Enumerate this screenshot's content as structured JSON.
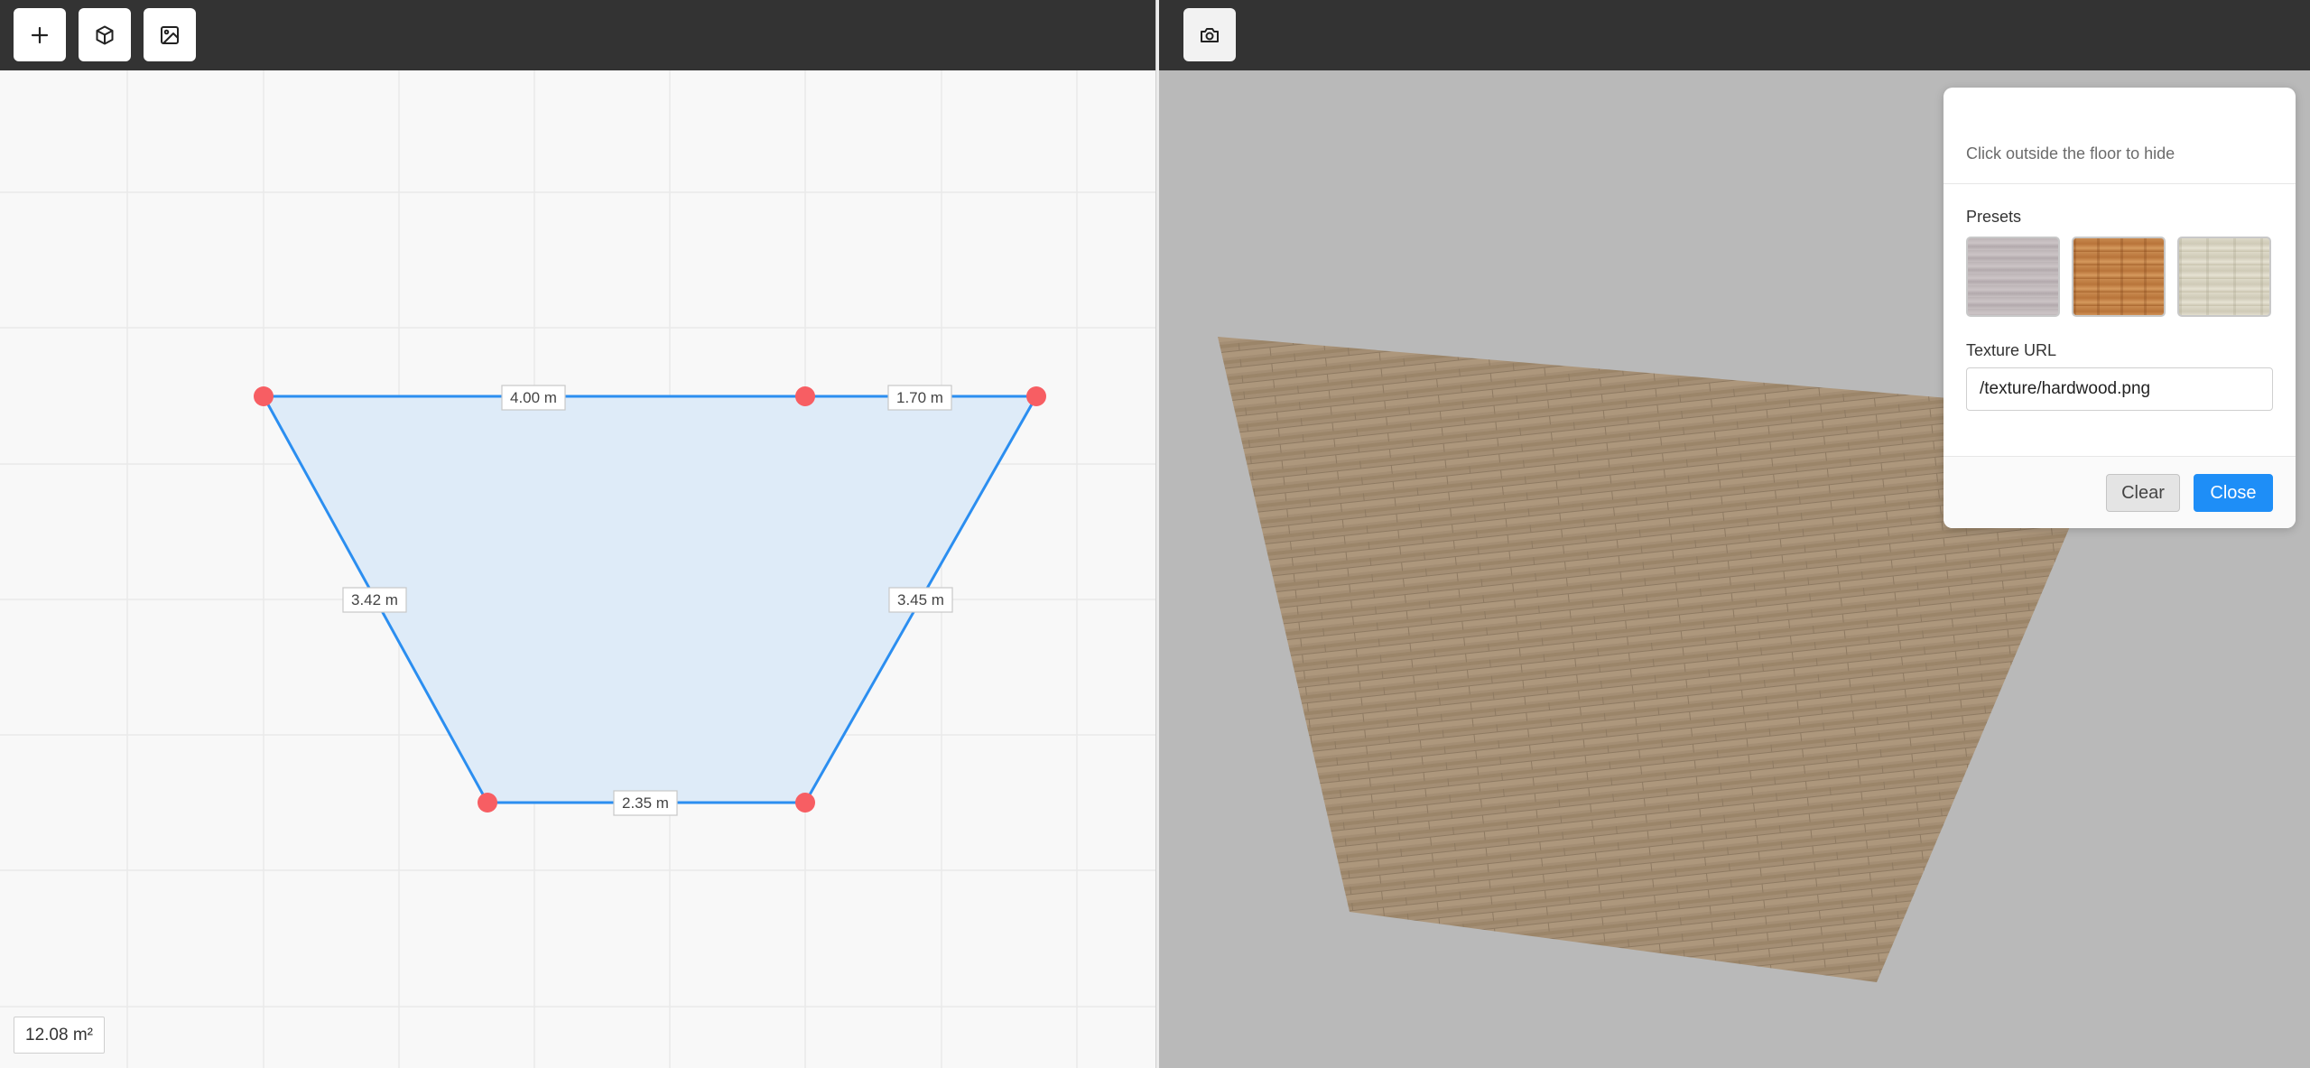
{
  "left_toolbar": {
    "buttons": [
      {
        "icon": "plus-icon",
        "label": "+"
      },
      {
        "icon": "cube-icon"
      },
      {
        "icon": "image-icon"
      }
    ]
  },
  "plan": {
    "dimensions": [
      {
        "edge": "top-left",
        "label": "4.00 m"
      },
      {
        "edge": "top-right",
        "label": "1.70 m"
      },
      {
        "edge": "left",
        "label": "3.42 m"
      },
      {
        "edge": "right",
        "label": "3.45 m"
      },
      {
        "edge": "bottom",
        "label": "2.35 m"
      }
    ],
    "area_label": "12.08 m²",
    "colors": {
      "fill": "#deebf8",
      "stroke": "#2b8ef0",
      "vertex": "#f75e63",
      "grid": "#e9e9e9"
    }
  },
  "right_toolbar": {
    "buttons": [
      {
        "icon": "camera-icon"
      }
    ]
  },
  "texture_panel": {
    "hint": "Click outside the floor to hide",
    "presets_label": "Presets",
    "presets": [
      {
        "name": "grey-wood-preset"
      },
      {
        "name": "hardwood-preset"
      },
      {
        "name": "pale-wood-preset"
      }
    ],
    "texture_url_label": "Texture URL",
    "texture_url_value": "/texture/hardwood.png",
    "clear_label": "Clear",
    "close_label": "Close"
  },
  "view3d": {
    "background_color": "#b9b9b9",
    "floor_color": "#a48e74"
  }
}
